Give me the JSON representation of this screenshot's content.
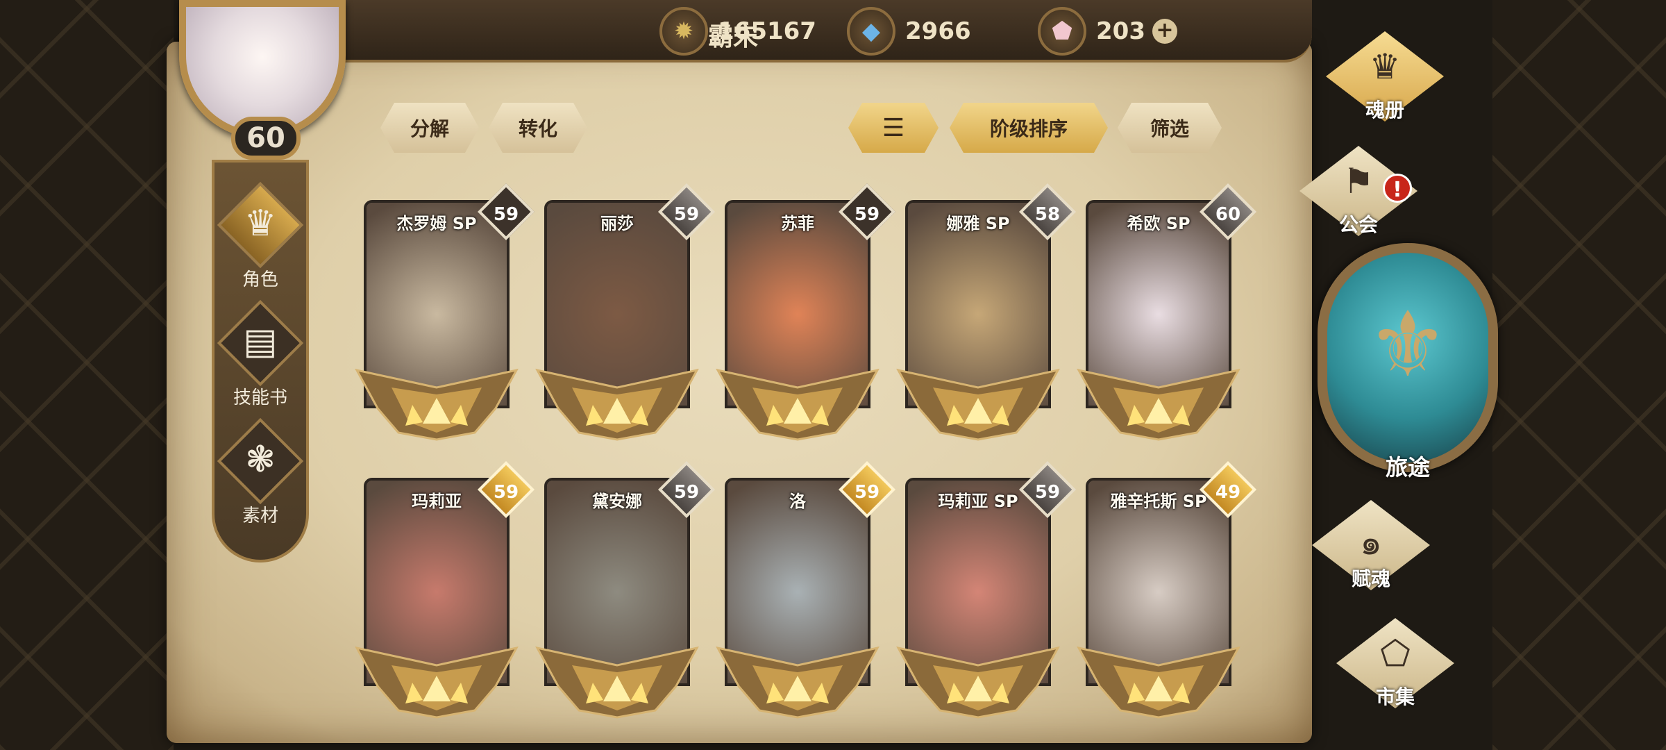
{
  "player": {
    "name": "霸宋",
    "level": "60"
  },
  "currencies": [
    {
      "icon": "gold-coin-icon",
      "value": "165167"
    },
    {
      "icon": "blue-crystal-icon",
      "value": "2966"
    },
    {
      "icon": "pink-gem-icon",
      "value": "203",
      "plus": "+"
    }
  ],
  "left_nav": [
    {
      "label": "角色",
      "icon": "helmet-icon",
      "active": true
    },
    {
      "label": "技能书",
      "icon": "skill-book-icon",
      "active": false
    },
    {
      "label": "素材",
      "icon": "material-icon",
      "active": false
    }
  ],
  "toolbar": {
    "decompose": "分解",
    "convert": "转化",
    "sort_order_icon": "sort-lines-icon",
    "sort_by": "阶级排序",
    "filter": "筛选"
  },
  "cards": [
    {
      "name": "杰罗姆 SP",
      "level": "59",
      "badge": "dark",
      "tone": "#c9b9a0"
    },
    {
      "name": "丽莎",
      "level": "59",
      "badge": "silver",
      "tone": "#7d5a44"
    },
    {
      "name": "苏菲",
      "level": "59",
      "badge": "dark",
      "tone": "#e08357"
    },
    {
      "name": "娜雅 SP",
      "level": "58",
      "badge": "silver",
      "tone": "#c6a777"
    },
    {
      "name": "希欧 SP",
      "level": "60",
      "badge": "silver",
      "tone": "#e9dde2"
    },
    {
      "name": "玛莉亚",
      "level": "59",
      "badge": "gold",
      "tone": "#c77a6c"
    },
    {
      "name": "黛安娜",
      "level": "59",
      "badge": "silver",
      "tone": "#8e8b80"
    },
    {
      "name": "洛",
      "level": "59",
      "badge": "gold",
      "tone": "#a9b1b4"
    },
    {
      "name": "玛莉亚 SP",
      "level": "59",
      "badge": "silver",
      "tone": "#d48576"
    },
    {
      "name": "雅辛托斯 SP",
      "level": "49",
      "badge": "gold",
      "tone": "#d7ccc4"
    }
  ],
  "right_nav": [
    {
      "label": "魂册",
      "icon": "soul-book-icon",
      "active": true
    },
    {
      "label": "公会",
      "icon": "guild-flag-icon",
      "alert": "!"
    },
    {
      "label": "旅途",
      "icon": "journey-emblem-icon"
    },
    {
      "label": "赋魂",
      "icon": "soul-swirl-icon"
    },
    {
      "label": "市集",
      "icon": "market-gem-icon"
    }
  ]
}
